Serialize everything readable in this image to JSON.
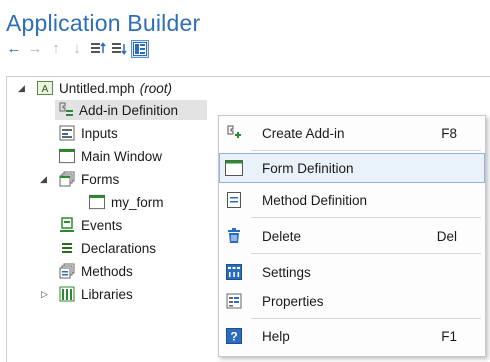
{
  "app": {
    "title": "Application Builder"
  },
  "toolbar": {
    "buttons": [
      "back-arrow-icon",
      "forward-arrow-icon",
      "move-up-icon",
      "move-down-icon",
      "expand-sections-icon",
      "collapse-sections-icon",
      "show-icon"
    ]
  },
  "tree": {
    "root": {
      "label": "Untitled.mph",
      "suffix": "(root)"
    },
    "items": [
      {
        "label": "Add-in Definition"
      },
      {
        "label": "Inputs"
      },
      {
        "label": "Main Window"
      },
      {
        "label": "Forms"
      },
      {
        "label": "my_form"
      },
      {
        "label": "Events"
      },
      {
        "label": "Declarations"
      },
      {
        "label": "Methods"
      },
      {
        "label": "Libraries"
      }
    ]
  },
  "context_menu": {
    "items": [
      {
        "label": "Create Add-in",
        "shortcut": "F8"
      },
      {
        "label": "Form Definition",
        "shortcut": ""
      },
      {
        "label": "Method Definition",
        "shortcut": ""
      },
      {
        "label": "Delete",
        "shortcut": "Del"
      },
      {
        "label": "Settings",
        "shortcut": ""
      },
      {
        "label": "Properties",
        "shortcut": ""
      },
      {
        "label": "Help",
        "shortcut": "F1"
      }
    ]
  },
  "colors": {
    "title": "#2e6fb5",
    "accent": "#2a6cc0",
    "hover": "#e9f1fb"
  }
}
